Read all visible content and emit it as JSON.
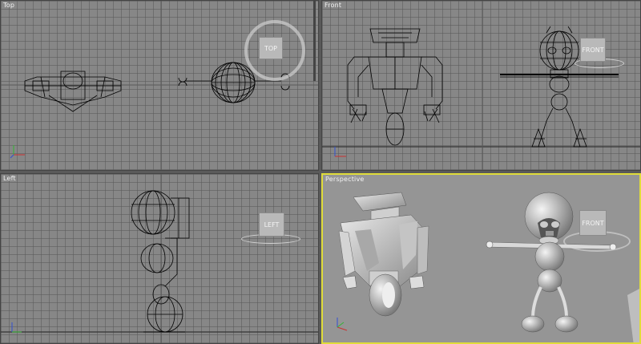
{
  "viewports": {
    "top": {
      "label": "Top",
      "cube_label": "TOP"
    },
    "front": {
      "label": "Front",
      "cube_label": "FRONT"
    },
    "left": {
      "label": "Left",
      "cube_label": "LEFT"
    },
    "perspective": {
      "label": "Perspective",
      "cube_label": "FRONT"
    }
  },
  "colors": {
    "viewport_bg": "#878787",
    "grid": "#6e6e6e",
    "active_border": "#e0dc3a",
    "axis_x": "#c83232",
    "axis_y": "#32b432",
    "axis_z": "#3250d2"
  }
}
